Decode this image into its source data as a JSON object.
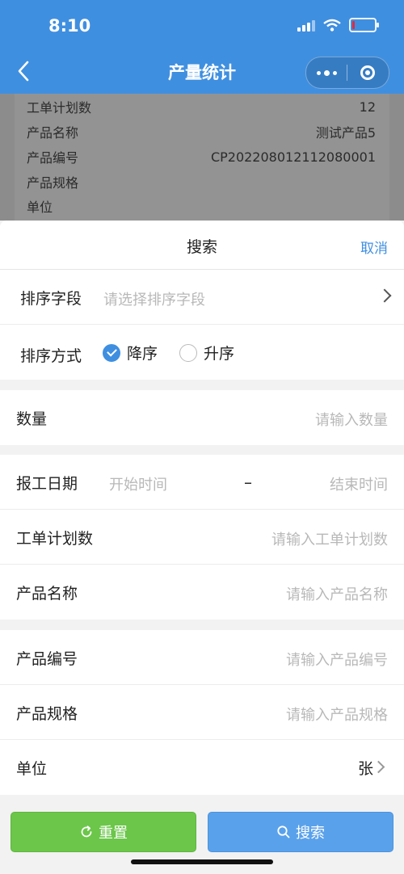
{
  "status": {
    "time": "8:10"
  },
  "header": {
    "title": "产量统计"
  },
  "background_card": {
    "rows": [
      {
        "label": "工单计划数",
        "value": "12"
      },
      {
        "label": "产品名称",
        "value": "测试产品5"
      },
      {
        "label": "产品编号",
        "value": "CP202208012112080001"
      },
      {
        "label": "产品规格",
        "value": ""
      },
      {
        "label": "单位",
        "value": ""
      }
    ]
  },
  "sheet": {
    "title": "搜索",
    "cancel": "取消",
    "sort_field": {
      "label": "排序字段",
      "placeholder": "请选择排序字段"
    },
    "sort_order": {
      "label": "排序方式",
      "desc": "降序",
      "asc": "升序",
      "selected": "desc"
    },
    "quantity": {
      "label": "数量",
      "placeholder": "请输入数量"
    },
    "report_date": {
      "label": "报工日期",
      "start_placeholder": "开始时间",
      "separator": "–",
      "end_placeholder": "结束时间"
    },
    "plan_count": {
      "label": "工单计划数",
      "placeholder": "请输入工单计划数"
    },
    "product_name": {
      "label": "产品名称",
      "placeholder": "请输入产品名称"
    },
    "product_code": {
      "label": "产品编号",
      "placeholder": "请输入产品编号"
    },
    "product_spec": {
      "label": "产品规格",
      "placeholder": "请输入产品规格"
    },
    "unit": {
      "label": "单位",
      "value": "张"
    }
  },
  "footer": {
    "reset": "重置",
    "search": "搜索"
  },
  "colors": {
    "primary": "#3f8fe0",
    "reset_green": "#6bc64a",
    "search_blue": "#5aa1eb"
  }
}
